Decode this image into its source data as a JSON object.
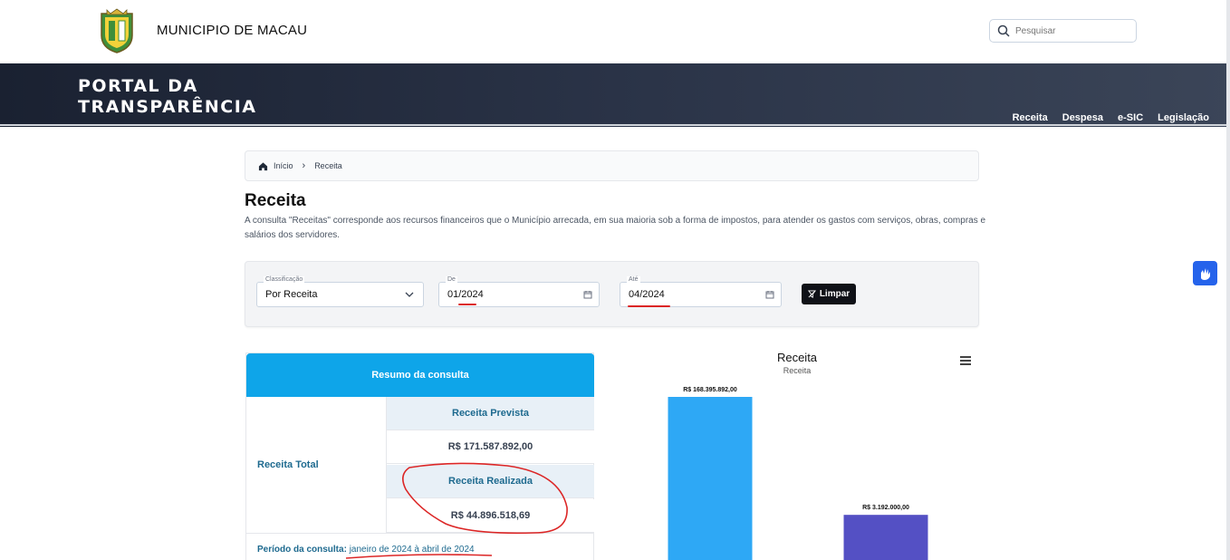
{
  "header": {
    "municipality": "MUNICIPIO DE MACAU",
    "search_placeholder": "Pesquisar"
  },
  "banner": {
    "title_line1": "PORTAL DA",
    "title_line2": "TRANSPARÊNCIA",
    "nav": [
      "Receita",
      "Despesa",
      "e-SIC",
      "Legislação"
    ]
  },
  "breadcrumb": {
    "home": "Início",
    "current": "Receita"
  },
  "page": {
    "title": "Receita",
    "description": "A consulta \"Receitas\" corresponde aos recursos financeiros que o Município arrecada, em sua maioria sob a forma de impostos, para atender os gastos com serviços, obras, compras e salários dos servidores."
  },
  "filters": {
    "classificacao_label": "Classificação",
    "classificacao_value": "Por Receita",
    "de_label": "De",
    "de_value": "01/2024",
    "ate_label": "Até",
    "ate_value": "04/2024",
    "clear_label": "Limpar"
  },
  "summary": {
    "header": "Resumo da consulta",
    "row_label": "Receita Total",
    "prevista_label": "Receita Prevista",
    "prevista_value": "R$ 171.587.892,00",
    "realizada_label": "Receita Realizada",
    "realizada_value": "R$ 44.896.518,69",
    "periodo_label": "Período da consulta:",
    "periodo_value": "janeiro de 2024 à abril de 2024"
  },
  "colors": {
    "accent": "#0ea5e9",
    "bar1": "#2ea8f5",
    "bar2": "#5450c4",
    "annotation": "#dc2626"
  },
  "chart_data": {
    "type": "bar",
    "title": "Receita",
    "subtitle": "Receita",
    "series": [
      {
        "label": "R$ 168.395.892,00",
        "value": 168395892
      },
      {
        "label": "R$ 3.192.000,00",
        "value": 3192000
      }
    ]
  }
}
